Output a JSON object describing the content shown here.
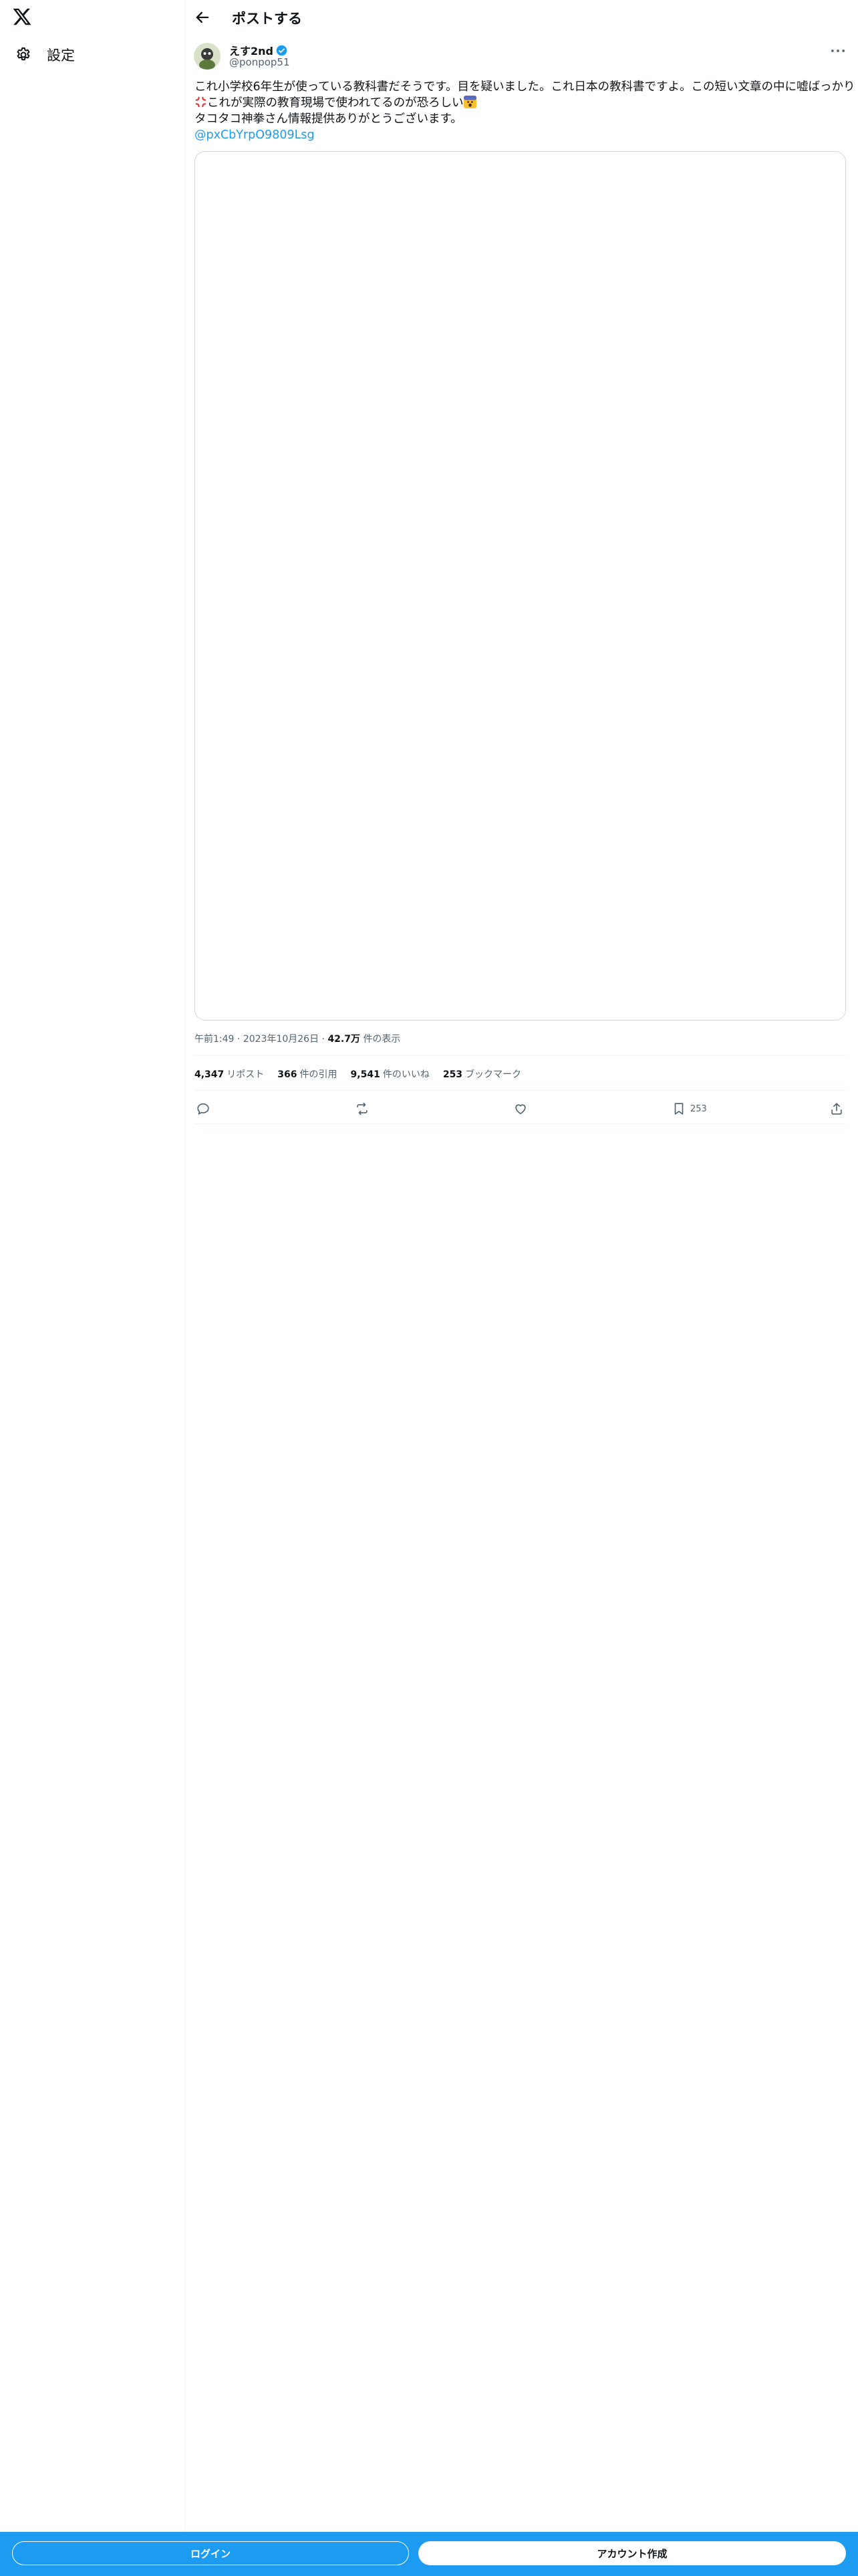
{
  "sidebar": {
    "logo_icon": "x-logo-icon",
    "items": [
      {
        "label": "設定",
        "icon": "gear-icon"
      }
    ]
  },
  "header": {
    "back_icon": "arrow-left-icon",
    "title": "ポストする"
  },
  "tweet": {
    "author": {
      "name": "えす2nd",
      "handle": "@ponpop51",
      "verified": true,
      "verified_color": "#1d9bf0"
    },
    "more_icon": "more-horizontal-icon",
    "text": {
      "line1": "これ小学校6年生が使っている教科書だそうです。目を疑いました。これ日本の教科書ですよ。この短い文章の中に嘘ばっかり",
      "line2": "これが実際の教育現場で使われてるのが恐ろしい",
      "line3": "タコタコ神拳さん情報提供ありがとうございます。",
      "link": "@pxCbYrpO9809Lsg",
      "emoji_1": "anger-symbol-emoji",
      "emoji_2": "fearful-face-emoji"
    },
    "meta": {
      "time": "午前1:49",
      "sep": "·",
      "date": "2023年10月26日",
      "views_count": "42.7万",
      "views_label": "件の表示"
    },
    "stats": {
      "reposts_count": "4,347",
      "reposts_label": "リポスト",
      "quotes_count": "366",
      "quotes_label": "件の引用",
      "likes_count": "9,541",
      "likes_label": "件のいいね",
      "bookmarks_count": "253",
      "bookmarks_label": "ブックマーク"
    },
    "actions": {
      "reply_icon": "reply-icon",
      "repost_icon": "repost-icon",
      "like_icon": "heart-icon",
      "bookmark_icon": "bookmark-icon",
      "bookmark_count": "253",
      "share_icon": "share-icon"
    }
  },
  "bottom_bar": {
    "login_label": "ログイン",
    "signup_label": "アカウント作成",
    "bg_color": "#1d9bf0"
  },
  "colors": {
    "accent": "#1d9bf0",
    "text": "#0f1419",
    "muted": "#536471",
    "border": "#cfd9de"
  }
}
